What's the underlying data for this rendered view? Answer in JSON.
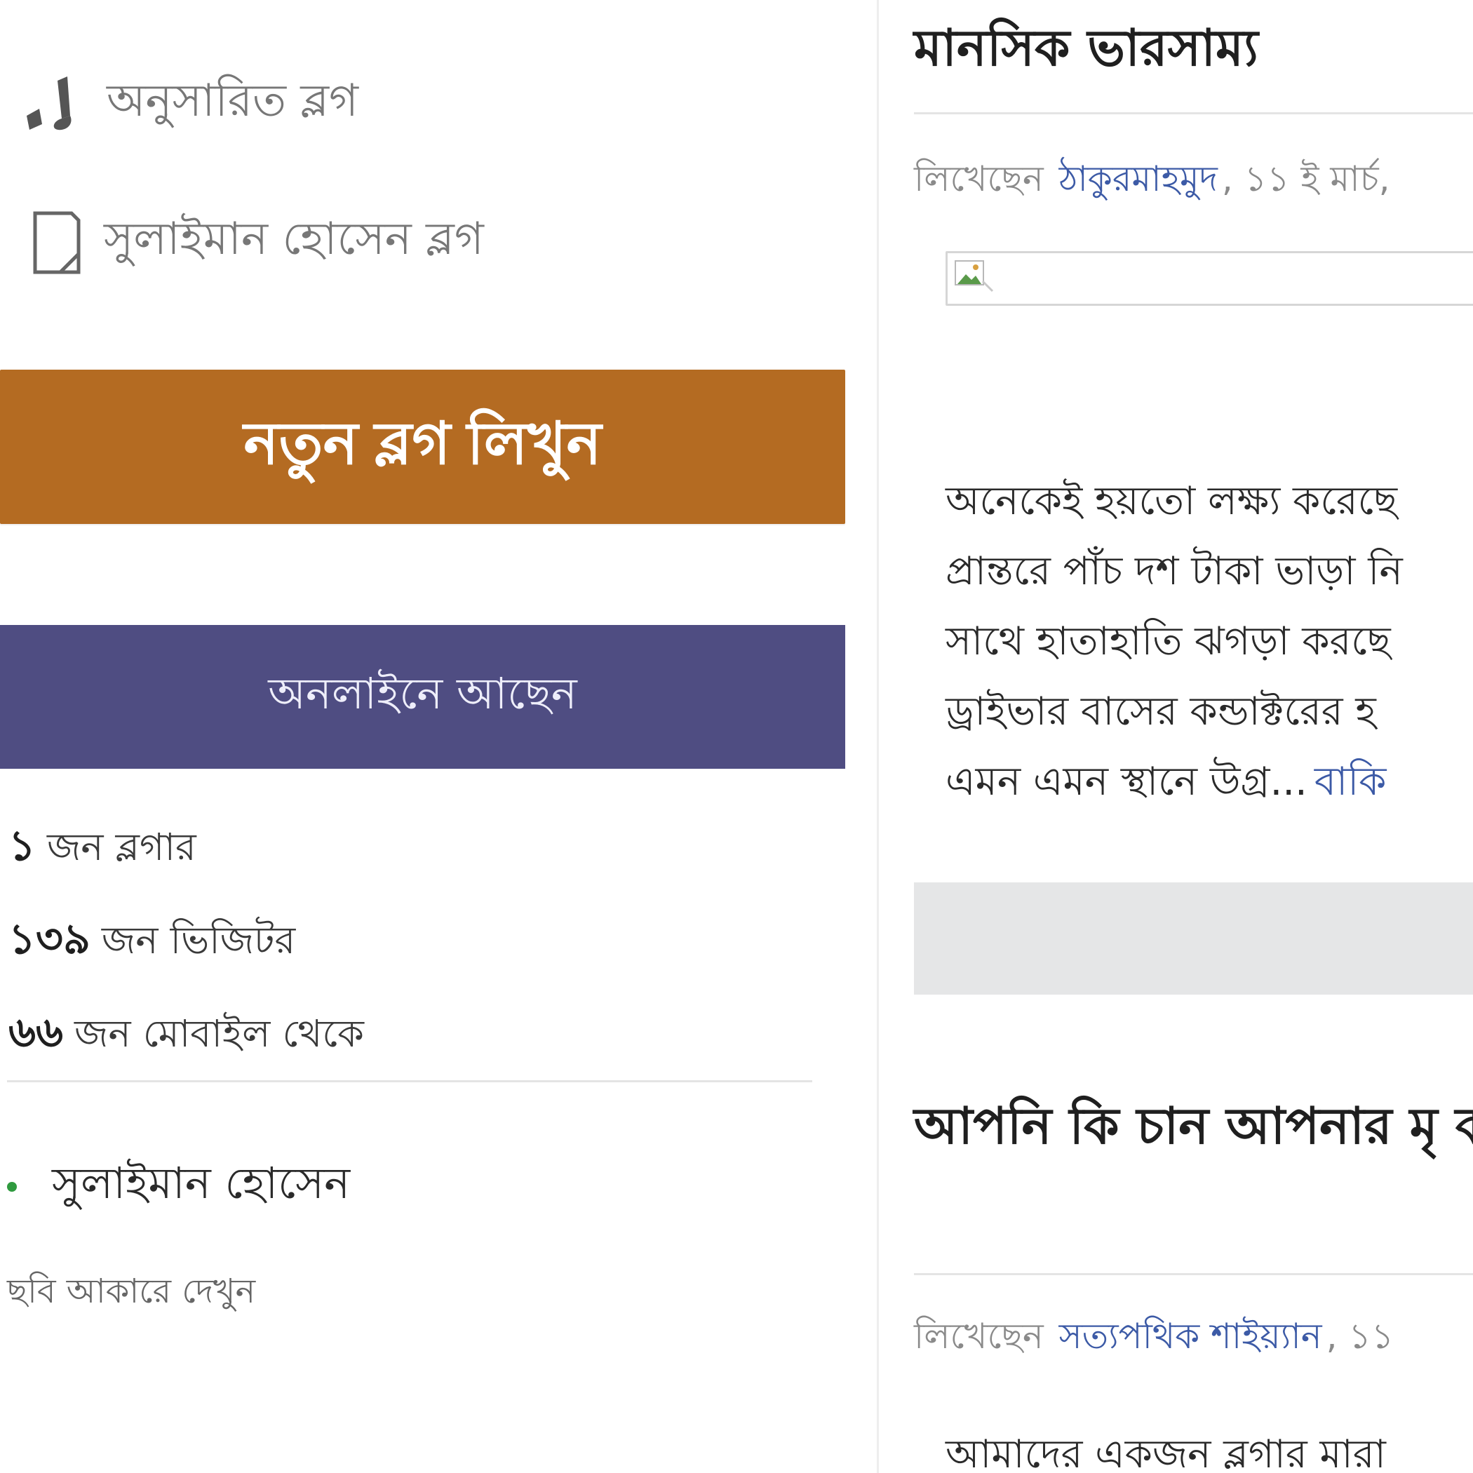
{
  "sidebar": {
    "nav": {
      "followed_blogs": {
        "label": "অনুসারিত ব্লগ",
        "icon": "followed-icon"
      },
      "user_blog": {
        "label": "সুলাইমান হোসেন ব্লগ",
        "icon": "document-icon"
      }
    },
    "new_post_button": "নতুন ব্লগ লিখুন",
    "online_section": {
      "title": "অনলাইনে আছেন",
      "stats": [
        {
          "num": "১",
          "label": "জন ব্লগার"
        },
        {
          "num": "১৩৯",
          "label": "জন ভিজিটর"
        },
        {
          "num": "৬৬",
          "label": "জন মোবাইল থেকে"
        }
      ],
      "online_users": [
        {
          "name": "সুলাইমান হোসেন",
          "status_color": "#2f9a3f"
        }
      ],
      "view_photos_link": "ছবি আকারে দেখুন"
    }
  },
  "posts": [
    {
      "title": "মানসিক ভারসাম্য",
      "byline_prefix": "লিখেছেন",
      "author": "ঠাকুরমাহমুদ",
      "date": ", ১১ ই মার্চ,",
      "has_broken_image": true,
      "excerpt_lines": [
        "অনেকেই হয়তো লক্ষ্য করেছে",
        "প্রান্তরে পাঁচ দশ টাকা ভাড়া নি",
        "সাথে হাতাহাতি ঝগড়া করছে",
        "ড্রাইভার বাসের কন্ডাক্টরের হ",
        "এমন এমন স্থানে উগ্র..."
      ],
      "read_more": "বাকি"
    },
    {
      "title": "আপনি কি চান আপনার মৃ করুক?",
      "byline_prefix": "লিখেছেন",
      "author": "সত্যপথিক শাইয়্যান",
      "date": ", ১১",
      "excerpt_first_line": "আমাদের একজন ব্লগার মারা"
    }
  ],
  "colors": {
    "cta_orange": "#b46b22",
    "online_header_purple": "#4f4d82",
    "link_blue": "#3c5aa6",
    "online_green": "#2f9a3f"
  }
}
